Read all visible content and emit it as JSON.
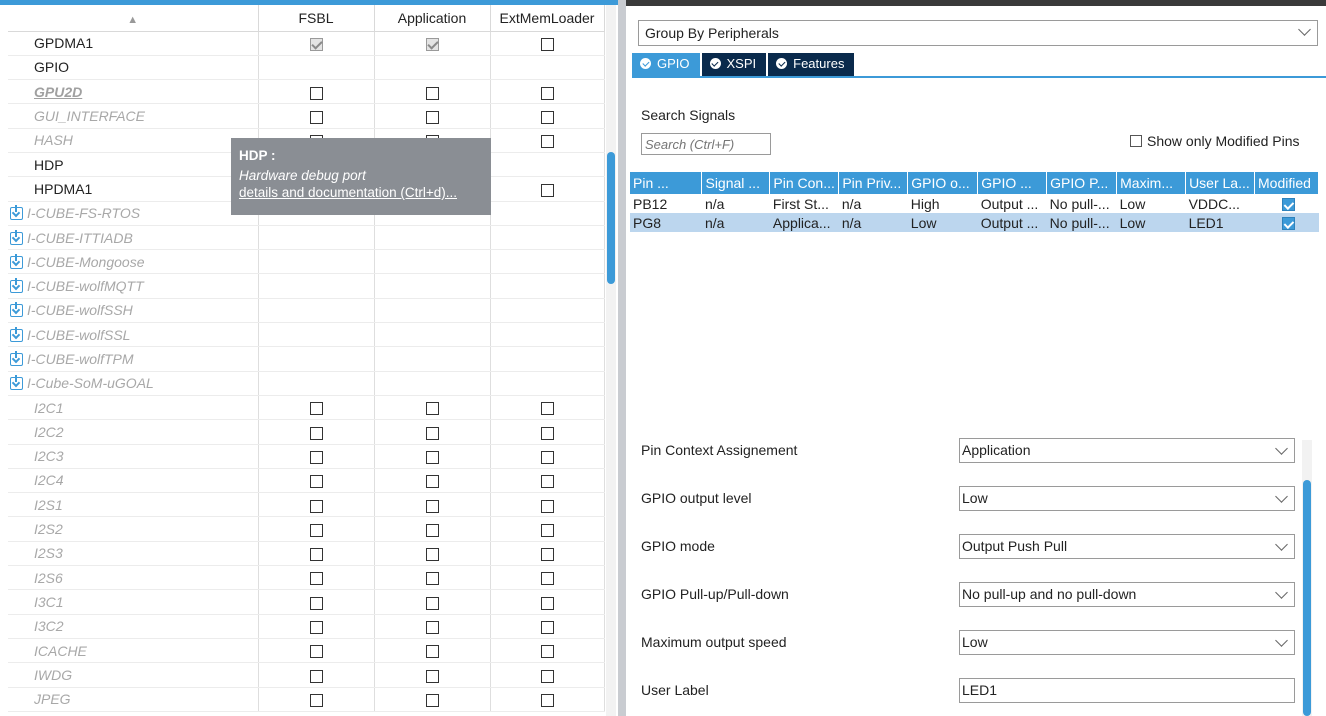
{
  "ip_table": {
    "headers": [
      "",
      "FSBL",
      "Application",
      "ExtMemLoader"
    ],
    "rows": [
      {
        "name": "GPDMA1",
        "style": "normal",
        "cube": false,
        "fsbl": "checked-grey",
        "app": "checked-grey",
        "ext": "unchecked"
      },
      {
        "name": "GPIO",
        "style": "selected",
        "cube": false,
        "fsbl": "none",
        "app": "none",
        "ext": "none"
      },
      {
        "name": "GPU2D",
        "style": "bold",
        "cube": false,
        "fsbl": "unchecked",
        "app": "unchecked",
        "ext": "unchecked"
      },
      {
        "name": "GUI_INTERFACE",
        "style": "disabled",
        "cube": false,
        "fsbl": "unchecked",
        "app": "unchecked",
        "ext": "unchecked"
      },
      {
        "name": "HASH",
        "style": "disabled",
        "cube": false,
        "fsbl": "unchecked",
        "app": "unchecked",
        "ext": "unchecked"
      },
      {
        "name": "HDP",
        "style": "normal",
        "cube": false,
        "fsbl": "none",
        "app": "none",
        "ext": "none"
      },
      {
        "name": "HPDMA1",
        "style": "normal",
        "cube": false,
        "fsbl": "none",
        "app": "none",
        "ext": "unchecked"
      },
      {
        "name": "I-CUBE-FS-RTOS",
        "style": "disabled",
        "cube": true,
        "fsbl": "none",
        "app": "none",
        "ext": "none"
      },
      {
        "name": "I-CUBE-ITTIADB",
        "style": "disabled",
        "cube": true,
        "fsbl": "none",
        "app": "none",
        "ext": "none"
      },
      {
        "name": "I-CUBE-Mongoose",
        "style": "disabled",
        "cube": true,
        "fsbl": "none",
        "app": "none",
        "ext": "none"
      },
      {
        "name": "I-CUBE-wolfMQTT",
        "style": "disabled",
        "cube": true,
        "fsbl": "none",
        "app": "none",
        "ext": "none"
      },
      {
        "name": "I-CUBE-wolfSSH",
        "style": "disabled",
        "cube": true,
        "fsbl": "none",
        "app": "none",
        "ext": "none"
      },
      {
        "name": "I-CUBE-wolfSSL",
        "style": "disabled",
        "cube": true,
        "fsbl": "none",
        "app": "none",
        "ext": "none"
      },
      {
        "name": "I-CUBE-wolfTPM",
        "style": "disabled",
        "cube": true,
        "fsbl": "none",
        "app": "none",
        "ext": "none"
      },
      {
        "name": "I-Cube-SoM-uGOAL",
        "style": "disabled",
        "cube": true,
        "fsbl": "none",
        "app": "none",
        "ext": "none"
      },
      {
        "name": "I2C1",
        "style": "disabled",
        "cube": false,
        "fsbl": "unchecked",
        "app": "unchecked",
        "ext": "unchecked"
      },
      {
        "name": "I2C2",
        "style": "disabled",
        "cube": false,
        "fsbl": "unchecked",
        "app": "unchecked",
        "ext": "unchecked"
      },
      {
        "name": "I2C3",
        "style": "disabled",
        "cube": false,
        "fsbl": "unchecked",
        "app": "unchecked",
        "ext": "unchecked"
      },
      {
        "name": "I2C4",
        "style": "disabled",
        "cube": false,
        "fsbl": "unchecked",
        "app": "unchecked",
        "ext": "unchecked"
      },
      {
        "name": "I2S1",
        "style": "disabled",
        "cube": false,
        "fsbl": "unchecked",
        "app": "unchecked",
        "ext": "unchecked"
      },
      {
        "name": "I2S2",
        "style": "disabled",
        "cube": false,
        "fsbl": "unchecked",
        "app": "unchecked",
        "ext": "unchecked"
      },
      {
        "name": "I2S3",
        "style": "disabled",
        "cube": false,
        "fsbl": "unchecked",
        "app": "unchecked",
        "ext": "unchecked"
      },
      {
        "name": "I2S6",
        "style": "disabled",
        "cube": false,
        "fsbl": "unchecked",
        "app": "unchecked",
        "ext": "unchecked"
      },
      {
        "name": "I3C1",
        "style": "disabled",
        "cube": false,
        "fsbl": "unchecked",
        "app": "unchecked",
        "ext": "unchecked"
      },
      {
        "name": "I3C2",
        "style": "disabled",
        "cube": false,
        "fsbl": "unchecked",
        "app": "unchecked",
        "ext": "unchecked"
      },
      {
        "name": "ICACHE",
        "style": "disabled",
        "cube": false,
        "fsbl": "unchecked",
        "app": "unchecked",
        "ext": "unchecked"
      },
      {
        "name": "IWDG",
        "style": "disabled",
        "cube": false,
        "fsbl": "unchecked",
        "app": "unchecked",
        "ext": "unchecked"
      },
      {
        "name": "JPEG",
        "style": "disabled",
        "cube": false,
        "fsbl": "unchecked",
        "app": "unchecked",
        "ext": "unchecked"
      }
    ]
  },
  "tooltip": {
    "title": "HDP :",
    "description": "Hardware debug port",
    "link": "details and documentation (Ctrl+d)..."
  },
  "group_by": {
    "value": "Group By Peripherals"
  },
  "tabs": [
    {
      "label": "GPIO",
      "active": true
    },
    {
      "label": "XSPI",
      "active": false
    },
    {
      "label": "Features",
      "active": false
    }
  ],
  "search": {
    "label": "Search Signals",
    "placeholder": "Search (Ctrl+F)"
  },
  "show_modified": {
    "label": "Show only Modified Pins"
  },
  "signal_table": {
    "headers": [
      "Pin ...",
      "Signal ...",
      "Pin Con...",
      "Pin Priv...",
      "GPIO o...",
      "GPIO ...",
      "GPIO P...",
      "Maxim...",
      "User La...",
      "Modified"
    ],
    "rows": [
      {
        "cells": [
          "PB12",
          "n/a",
          "First St...",
          "n/a",
          "High",
          "Output ...",
          "No pull-...",
          "Low",
          "VDDC..."
        ],
        "modified": true,
        "selected": false
      },
      {
        "cells": [
          "PG8",
          "n/a",
          "Applica...",
          "n/a",
          "Low",
          "Output ...",
          "No pull-...",
          "Low",
          "LED1"
        ],
        "modified": true,
        "selected": true
      }
    ]
  },
  "properties": [
    {
      "label": "Pin Context Assignement",
      "value": "Application",
      "kind": "select"
    },
    {
      "label": "GPIO output level",
      "value": "Low",
      "kind": "select"
    },
    {
      "label": "GPIO mode",
      "value": "Output Push Pull",
      "kind": "select"
    },
    {
      "label": "GPIO Pull-up/Pull-down",
      "value": "No pull-up and no pull-down",
      "kind": "select"
    },
    {
      "label": "Maximum output speed",
      "value": "Low",
      "kind": "select"
    },
    {
      "label": "User Label",
      "value": "LED1",
      "kind": "input"
    }
  ],
  "colors": {
    "accent": "#3c9ad8",
    "tab_dark": "#0a2a4c",
    "tooltip_bg": "#8a8e94",
    "selected_row": "#bcd6ee"
  }
}
